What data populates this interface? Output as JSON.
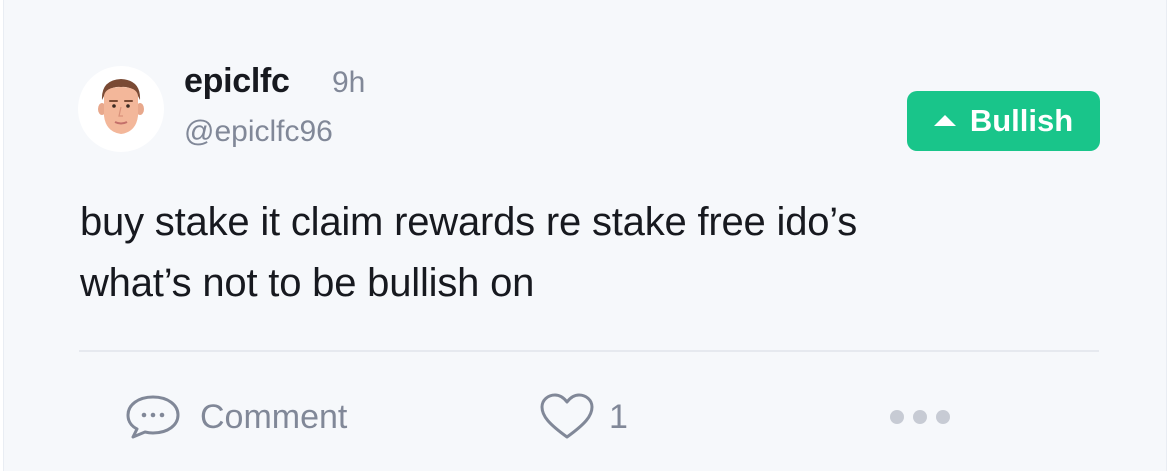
{
  "post": {
    "author": {
      "username": "epiclfc",
      "time": "9h",
      "handle": "@epiclfc96",
      "avatar": "cartoon-man-face-avatar"
    },
    "sentiment": {
      "label": "Bullish",
      "icon": "triangle-up-icon",
      "color": "#19c58a"
    },
    "text_line1": "buy stake it claim rewards re stake free ido’s",
    "text_line2": "what’s not to be bullish on"
  },
  "actions": {
    "comment_label": "Comment",
    "comment_icon": "speech-bubble-icon",
    "like_count": "1",
    "like_icon": "heart-icon",
    "more_icon": "ellipsis-icon"
  },
  "colors": {
    "background": "#f6f8fb",
    "text_primary": "#17191f",
    "text_muted": "#818898",
    "accent": "#19c58a"
  }
}
